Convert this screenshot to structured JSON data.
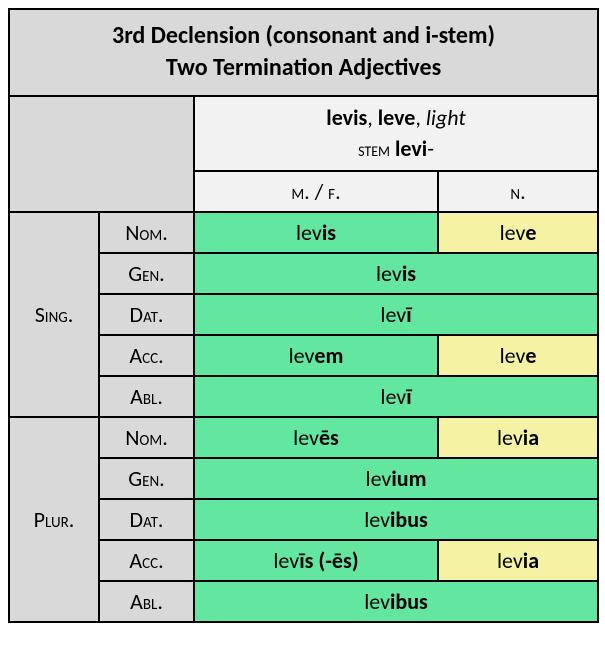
{
  "title_line1": "3rd Declension (consonant and i-stem)",
  "title_line2": "Two Termination Adjectives",
  "headword": {
    "mf_form": "levis",
    "n_form": "leve",
    "meaning": "light",
    "stem_label": "stem",
    "stem": "levi",
    "stem_suffix": "-"
  },
  "gender_labels": {
    "mf": "m. / f.",
    "n": "n."
  },
  "numbers": {
    "sing": "Sing.",
    "plur": "Plur."
  },
  "cases": {
    "nom": "Nom.",
    "gen": "Gen.",
    "dat": "Dat.",
    "acc": "Acc.",
    "abl": "Abl."
  },
  "chart_data": {
    "type": "table",
    "title": "3rd Declension Two Termination Adjectives: levis, leve (light)",
    "stem": "levi",
    "columns": [
      "m./f.",
      "n."
    ],
    "rows": [
      {
        "number": "Sing.",
        "case": "Nom.",
        "mf": {
          "stem": "lev",
          "ending": "is"
        },
        "n": {
          "stem": "lev",
          "ending": "e"
        }
      },
      {
        "number": "Sing.",
        "case": "Gen.",
        "both": {
          "stem": "lev",
          "ending": "is"
        }
      },
      {
        "number": "Sing.",
        "case": "Dat.",
        "both": {
          "stem": "lev",
          "ending": "ī"
        }
      },
      {
        "number": "Sing.",
        "case": "Acc.",
        "mf": {
          "stem": "lev",
          "ending": "em"
        },
        "n": {
          "stem": "lev",
          "ending": "e"
        }
      },
      {
        "number": "Sing.",
        "case": "Abl.",
        "both": {
          "stem": "lev",
          "ending": "ī"
        }
      },
      {
        "number": "Plur.",
        "case": "Nom.",
        "mf": {
          "stem": "lev",
          "ending": "ēs"
        },
        "n": {
          "stem": "lev",
          "ending": "ia"
        }
      },
      {
        "number": "Plur.",
        "case": "Gen.",
        "both": {
          "stem": "lev",
          "ending": "ium"
        }
      },
      {
        "number": "Plur.",
        "case": "Dat.",
        "both": {
          "stem": "lev",
          "ending": "ibus"
        }
      },
      {
        "number": "Plur.",
        "case": "Acc.",
        "mf": {
          "stem": "lev",
          "ending": "īs (-ēs)"
        },
        "n": {
          "stem": "lev",
          "ending": "ia"
        }
      },
      {
        "number": "Plur.",
        "case": "Abl.",
        "both": {
          "stem": "lev",
          "ending": "ibus"
        }
      }
    ]
  }
}
